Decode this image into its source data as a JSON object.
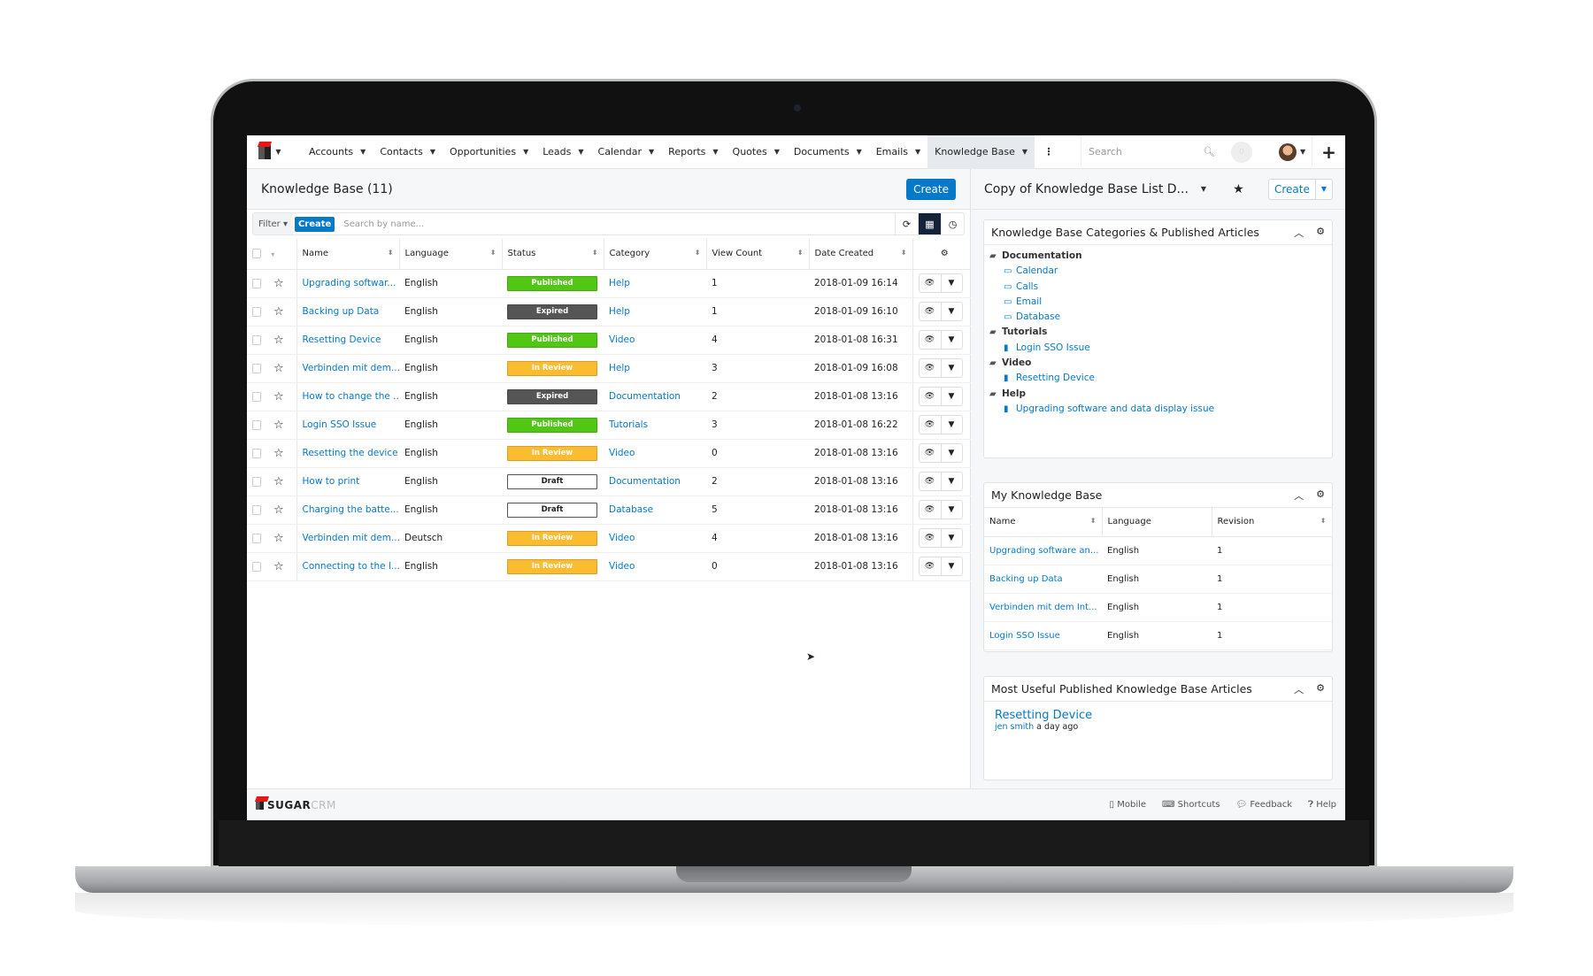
{
  "nav": {
    "items": [
      "Accounts",
      "Contacts",
      "Opportunities",
      "Leads",
      "Calendar",
      "Reports",
      "Quotes",
      "Documents",
      "Emails",
      "Knowledge Base"
    ],
    "active": "Knowledge Base",
    "search_placeholder": "Search",
    "notification_count": "0"
  },
  "list": {
    "title": "Knowledge Base (11)",
    "create_label": "Create",
    "filter_label": "Filter",
    "filter_create": "Create",
    "search_placeholder": "Search by name...",
    "columns": [
      "Name",
      "Language",
      "Status",
      "Category",
      "View Count",
      "Date Created"
    ],
    "rows": [
      [
        "Upgrading softwar...",
        "English",
        "Published",
        "Help",
        "1",
        "2018-01-09 16:14"
      ],
      [
        "Backing up Data",
        "English",
        "Expired",
        "Help",
        "1",
        "2018-01-09 16:10"
      ],
      [
        "Resetting Device",
        "English",
        "Published",
        "Video",
        "4",
        "2018-01-08 16:31"
      ],
      [
        "Verbinden mit dem...",
        "English",
        "In Review",
        "Help",
        "3",
        "2018-01-09 16:08"
      ],
      [
        "How to change the ...",
        "English",
        "Expired",
        "Documentation",
        "2",
        "2018-01-08 13:16"
      ],
      [
        "Login SSO Issue",
        "English",
        "Published",
        "Tutorials",
        "3",
        "2018-01-08 16:22"
      ],
      [
        "Resetting the device",
        "English",
        "In Review",
        "Video",
        "0",
        "2018-01-08 13:16"
      ],
      [
        "How to print",
        "English",
        "Draft",
        "Documentation",
        "2",
        "2018-01-08 13:16"
      ],
      [
        "Charging the batte...",
        "English",
        "Draft",
        "Database",
        "5",
        "2018-01-08 13:16"
      ],
      [
        "Verbinden mit dem...",
        "Deutsch",
        "In Review",
        "Video",
        "4",
        "2018-01-08 13:16"
      ],
      [
        "Connecting to the l...",
        "English",
        "In Review",
        "Video",
        "0",
        "2018-01-08 13:16"
      ]
    ]
  },
  "status_colors": {
    "Published": "#52c614",
    "Expired": "#555555",
    "In Review": "#fbbc2f",
    "Draft": "#ffffff"
  },
  "accent": "#0679c8",
  "dashboard": {
    "title": "Copy of Knowledge Base List D...",
    "create_label": "Create",
    "categories": {
      "title": "Knowledge Base Categories & Published Articles",
      "tree": [
        {
          "label": "Documentation",
          "children": [
            {
              "label": "Calendar",
              "type": "folder"
            },
            {
              "label": "Calls",
              "type": "folder"
            },
            {
              "label": "Email",
              "type": "folder"
            },
            {
              "label": "Database",
              "type": "folder"
            }
          ]
        },
        {
          "label": "Tutorials",
          "children": [
            {
              "label": "Login SSO Issue",
              "type": "article"
            }
          ]
        },
        {
          "label": "Video",
          "children": [
            {
              "label": "Resetting Device",
              "type": "article"
            }
          ]
        },
        {
          "label": "Help",
          "children": [
            {
              "label": "Upgrading software and data display issue",
              "type": "article"
            }
          ]
        }
      ]
    },
    "my_kb": {
      "title": "My Knowledge Base",
      "columns": [
        "Name",
        "Language",
        "Revision"
      ],
      "rows": [
        [
          "Upgrading software an...",
          "English",
          "1"
        ],
        [
          "Backing up Data",
          "English",
          "1"
        ],
        [
          "Verbinden mit dem Int...",
          "English",
          "1"
        ],
        [
          "Login SSO Issue",
          "English",
          "1"
        ]
      ]
    },
    "most_useful": {
      "title": "Most Useful Published Knowledge Base Articles",
      "article": "Resetting Device",
      "author": "jen smith",
      "when": "a day ago"
    }
  },
  "footer": {
    "brand_a": "SUGAR",
    "brand_b": "CRM",
    "links": [
      "Mobile",
      "Shortcuts",
      "Feedback",
      "Help"
    ]
  }
}
